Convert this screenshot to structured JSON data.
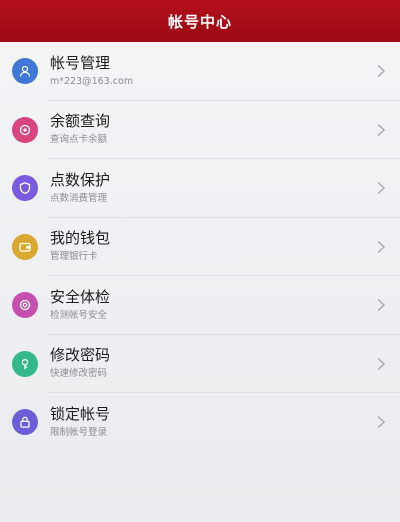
{
  "header": {
    "title": "帐号中心"
  },
  "items": [
    {
      "label": "帐号管理",
      "sub": "m*223@163.com",
      "color": "#3f78d6",
      "icon": "person-icon"
    },
    {
      "label": "余额查询",
      "sub": "查询点卡余额",
      "color": "#d9437f",
      "icon": "coin-icon"
    },
    {
      "label": "点数保护",
      "sub": "点数消费管理",
      "color": "#7a5be0",
      "icon": "shield-icon"
    },
    {
      "label": "我的钱包",
      "sub": "管理银行卡",
      "color": "#d9a830",
      "icon": "wallet-icon"
    },
    {
      "label": "安全体检",
      "sub": "检测帐号安全",
      "color": "#c64fb0",
      "icon": "checkup-icon"
    },
    {
      "label": "修改密码",
      "sub": "快速修改密码",
      "color": "#33b889",
      "icon": "key-icon"
    },
    {
      "label": "锁定帐号",
      "sub": "限制帐号登录",
      "color": "#6a5fd8",
      "icon": "lock-icon"
    }
  ]
}
